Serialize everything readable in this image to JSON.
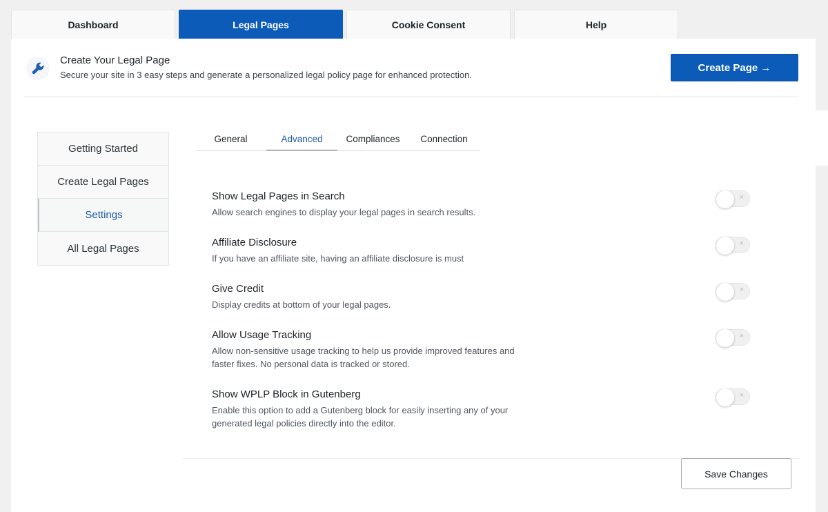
{
  "top_tabs": [
    {
      "label": "Dashboard",
      "active": false
    },
    {
      "label": "Legal Pages",
      "active": true
    },
    {
      "label": "Cookie Consent",
      "active": false
    },
    {
      "label": "Help",
      "active": false
    }
  ],
  "banner": {
    "icon": "wrench-icon",
    "title": "Create Your Legal Page",
    "subtitle": "Secure your site in 3 easy steps and generate a personalized legal policy page for enhanced protection.",
    "button_label": "Create Page →"
  },
  "side_nav": [
    {
      "label": "Getting Started",
      "active": false
    },
    {
      "label": "Create Legal Pages",
      "active": false
    },
    {
      "label": "Settings",
      "active": true
    },
    {
      "label": "All Legal Pages",
      "active": false
    }
  ],
  "sub_tabs": [
    {
      "label": "General",
      "active": false
    },
    {
      "label": "Advanced",
      "active": true
    },
    {
      "label": "Compliances",
      "active": false
    },
    {
      "label": "Connection",
      "active": false
    }
  ],
  "settings": [
    {
      "title": "Show Legal Pages in Search",
      "description": "Allow search engines to display your legal pages in search results.",
      "enabled": false
    },
    {
      "title": "Affiliate Disclosure",
      "description": "If you have an affiliate site, having an affiliate disclosure is must",
      "enabled": false
    },
    {
      "title": "Give Credit",
      "description": "Display credits at bottom of your legal pages.",
      "enabled": false
    },
    {
      "title": "Allow Usage Tracking",
      "description": "Allow non-sensitive usage tracking to help us provide improved features and faster fixes. No personal data is tracked or stored.",
      "enabled": false
    },
    {
      "title": "Show WPLP Block in Gutenberg",
      "description": "Enable this option to add a Gutenberg block for easily inserting any of your generated legal policies directly into the editor.",
      "enabled": false
    }
  ],
  "toggle_off_glyph": "×",
  "save_label": "Save Changes",
  "colors": {
    "primary": "#0c5bb8",
    "active_link": "#1d5aa8"
  }
}
